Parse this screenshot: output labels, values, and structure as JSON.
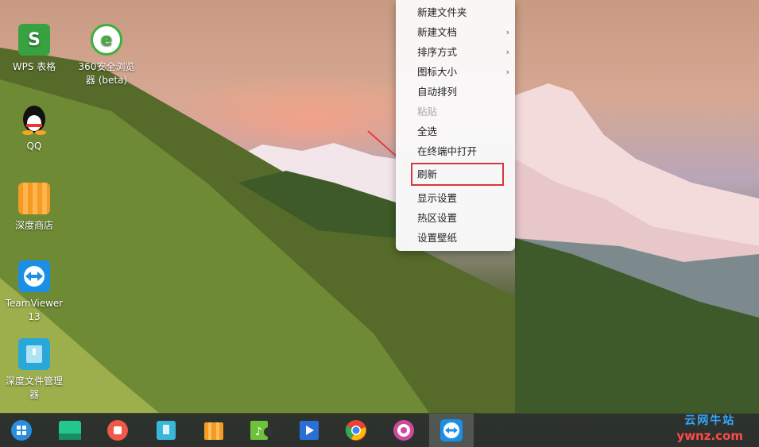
{
  "desktop_icons": [
    {
      "label": "WPS 表格",
      "icon": "wps-spreadsheet-icon",
      "color": "#37a23f"
    },
    {
      "label": "360安全浏览器 (beta)",
      "icon": "360-browser-icon",
      "color": "#3cb13a"
    },
    {
      "label": "QQ",
      "icon": "qq-penguin-icon",
      "color": "#111111"
    },
    {
      "label": "深度商店",
      "icon": "deepin-store-icon",
      "color": "#f59a23"
    },
    {
      "label": "TeamViewer 13",
      "icon": "teamviewer-icon",
      "color": "#1b8ee6"
    },
    {
      "label": "深度文件管理器",
      "icon": "file-manager-icon",
      "color": "#29a7d8"
    }
  ],
  "context_menu": {
    "items": [
      {
        "label": "新建文件夹"
      },
      {
        "label": "新建文档",
        "submenu": "›"
      },
      {
        "label": "排序方式",
        "submenu": "›"
      },
      {
        "label": "图标大小",
        "submenu": "›"
      },
      {
        "label": "自动排列"
      },
      {
        "label": "粘贴",
        "disabled": true
      },
      {
        "label": "全选"
      },
      {
        "label": "在终端中打开"
      },
      {
        "label": "刷新",
        "highlighted": true
      },
      {
        "label": "显示设置"
      },
      {
        "label": "热区设置"
      },
      {
        "label": "设置壁纸"
      }
    ]
  },
  "dock": {
    "items": [
      {
        "name": "launcher-icon",
        "color": "#2a8de0"
      },
      {
        "name": "terminal-icon",
        "color": "#23c78b"
      },
      {
        "name": "screen-recorder-icon",
        "color": "#f0594a"
      },
      {
        "name": "file-manager-icon",
        "color": "#3ab6d9"
      },
      {
        "name": "deepin-store-icon",
        "color": "#f59a23"
      },
      {
        "name": "music-icon",
        "color": "#6dc23a"
      },
      {
        "name": "video-player-icon",
        "color": "#2a6fd6"
      },
      {
        "name": "chrome-icon",
        "color": "#e84335"
      },
      {
        "name": "settings-icon",
        "color": "#d04a9c"
      },
      {
        "name": "teamviewer-icon",
        "color": "#1b8ee6"
      }
    ]
  },
  "watermark": {
    "cn": "云网牛站",
    "en": "ywnz.com"
  },
  "colors": {
    "highlight": "#d9363e",
    "arrow": "#e04040"
  }
}
